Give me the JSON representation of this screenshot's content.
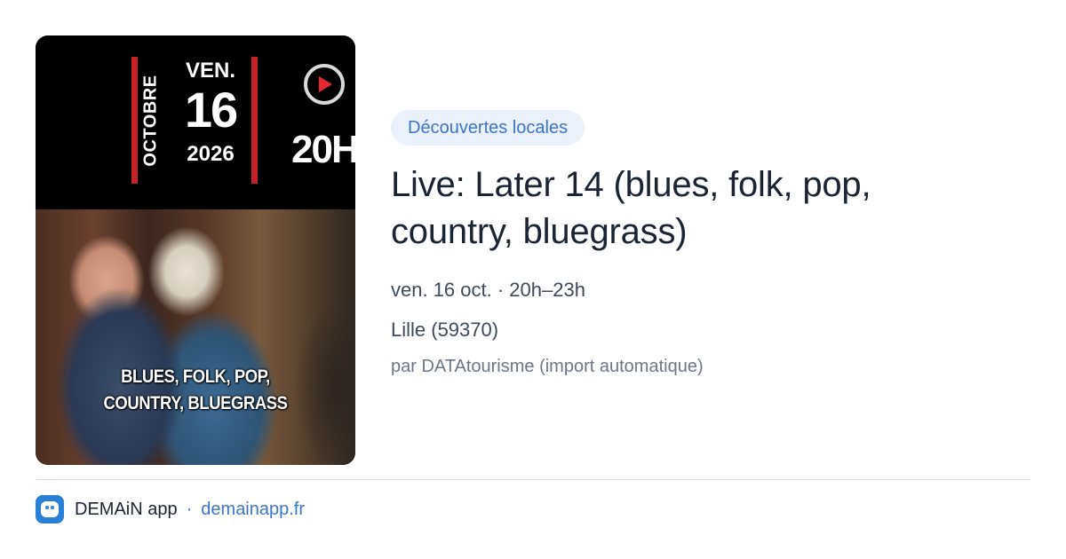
{
  "poster": {
    "month": "OCTOBRE",
    "day_name": "VEN.",
    "day_number": "16",
    "year": "2026",
    "time": "20H",
    "genre_line1": "BLUES, FOLK, POP,",
    "genre_line2": "COUNTRY, BLUEGRASS"
  },
  "event": {
    "category": "Découvertes locales",
    "title": "Live: Later 14 (blues, folk, pop, country, bluegrass)",
    "datetime": "ven. 16 oct. · 20h–23h",
    "location": "Lille (59370)",
    "source": "par DATAtourisme (import automatique)"
  },
  "footer": {
    "app_name": "DEMAiN app",
    "separator": "·",
    "site": "demainapp.fr"
  },
  "colors": {
    "accent": "#3a76c7",
    "category_bg": "#eaf1fb",
    "poster_red": "#c8202a",
    "app_icon": "#2a7fd8"
  },
  "icons": {
    "app": "demain-app-icon",
    "poster_logo": "play-circle-icon"
  }
}
